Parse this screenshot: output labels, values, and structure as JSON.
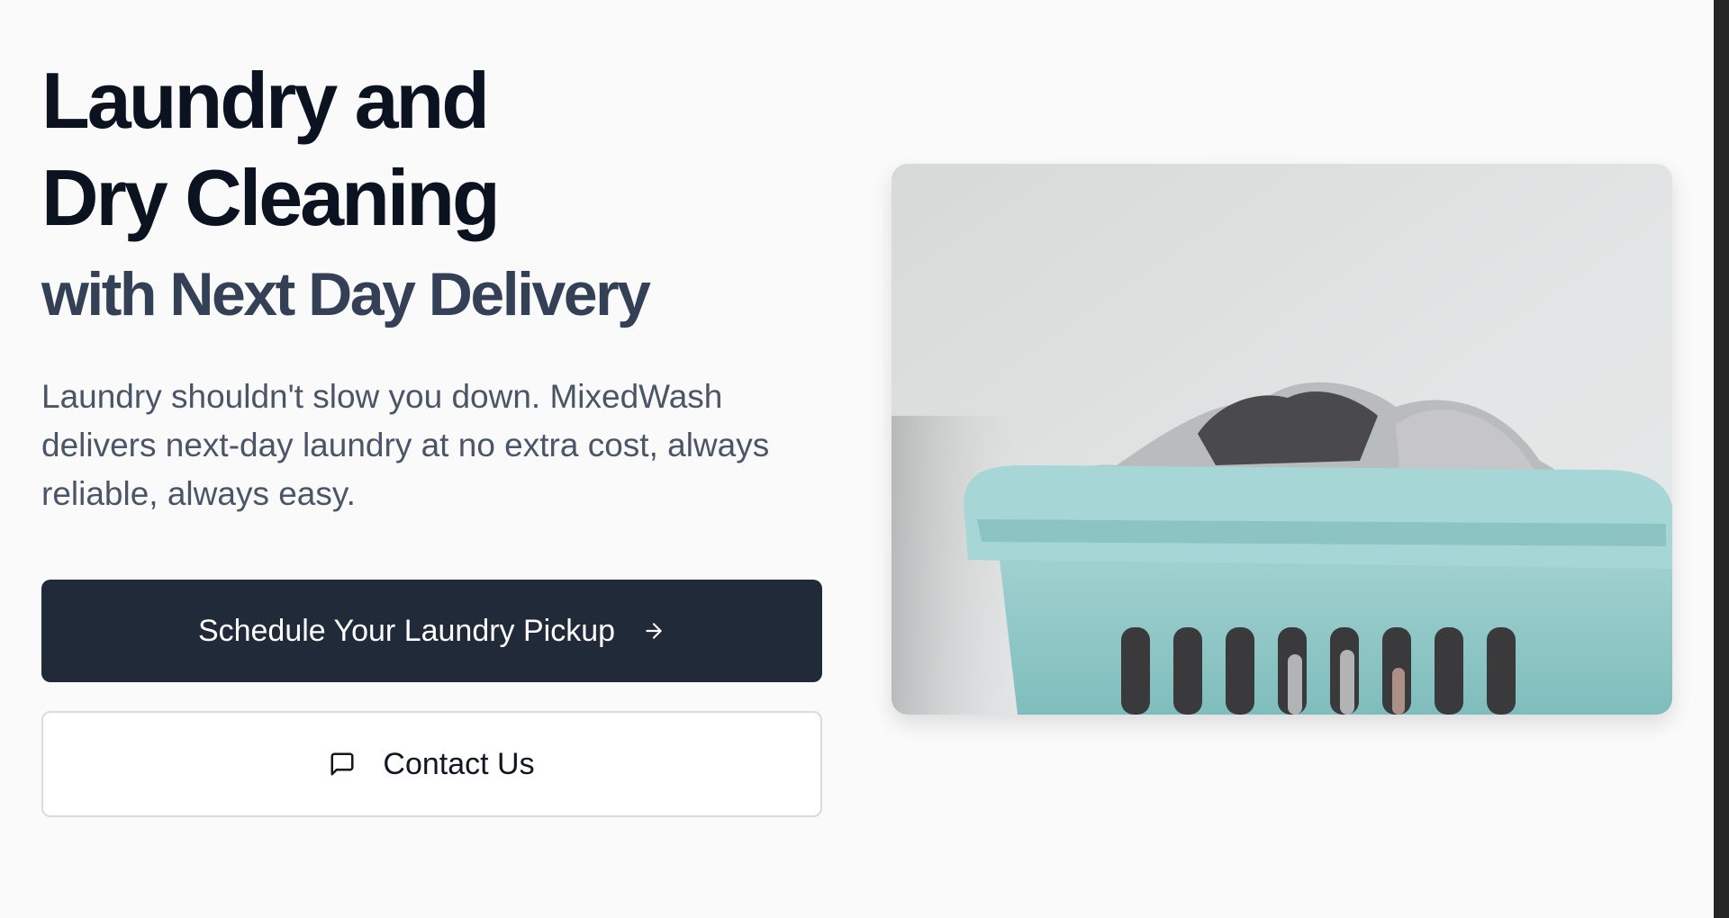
{
  "hero": {
    "title_line1": "Laundry and",
    "title_line2": "Dry Cleaning",
    "subtitle": "with Next Day Delivery",
    "description": "Laundry shouldn't slow you down. MixedWash delivers next-day laundry at no extra cost, always reliable, always easy."
  },
  "buttons": {
    "primary_label": "Schedule Your Laundry Pickup",
    "primary_icon": "arrow-right-icon",
    "secondary_label": "Contact Us",
    "secondary_icon": "message-square-icon"
  },
  "image": {
    "subject": "laundry-basket"
  },
  "colors": {
    "title": "#0b1220",
    "subtitle": "#344056",
    "body_text": "#4a5568",
    "primary_button": "#212a39",
    "basket": "#8ec9c8"
  }
}
